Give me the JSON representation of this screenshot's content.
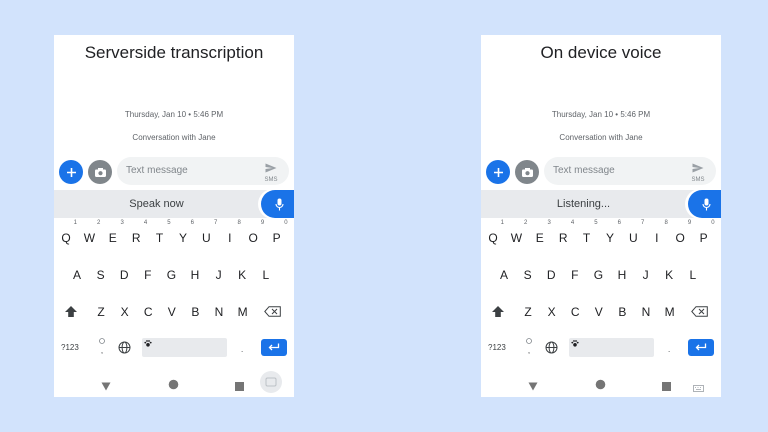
{
  "panels": [
    {
      "title": "Serverside transcription",
      "date": "Thursday, Jan 10 • 5:46 PM",
      "conversation": "Conversation with Jane",
      "placeholder": "Text message",
      "sms": "SMS",
      "voice_status": "Speak now"
    },
    {
      "title": "On device voice",
      "date": "Thursday, Jan 10 • 5:46 PM",
      "conversation": "Conversation with Jane",
      "placeholder": "Text message",
      "sms": "SMS",
      "voice_status": "Listening..."
    }
  ],
  "keyboard": {
    "row1": [
      "Q",
      "W",
      "E",
      "R",
      "T",
      "Y",
      "U",
      "I",
      "O",
      "P"
    ],
    "row1_nums": [
      "1",
      "2",
      "3",
      "4",
      "5",
      "6",
      "7",
      "8",
      "9",
      "0"
    ],
    "row2": [
      "A",
      "S",
      "D",
      "F",
      "G",
      "H",
      "J",
      "K",
      "L"
    ],
    "row3": [
      "Z",
      "X",
      "C",
      "V",
      "B",
      "N",
      "M"
    ],
    "sym_label": "?123",
    "comma": ",",
    "period": "."
  },
  "colors": {
    "background": "#d2e3fc",
    "accent": "#1a73e8"
  }
}
